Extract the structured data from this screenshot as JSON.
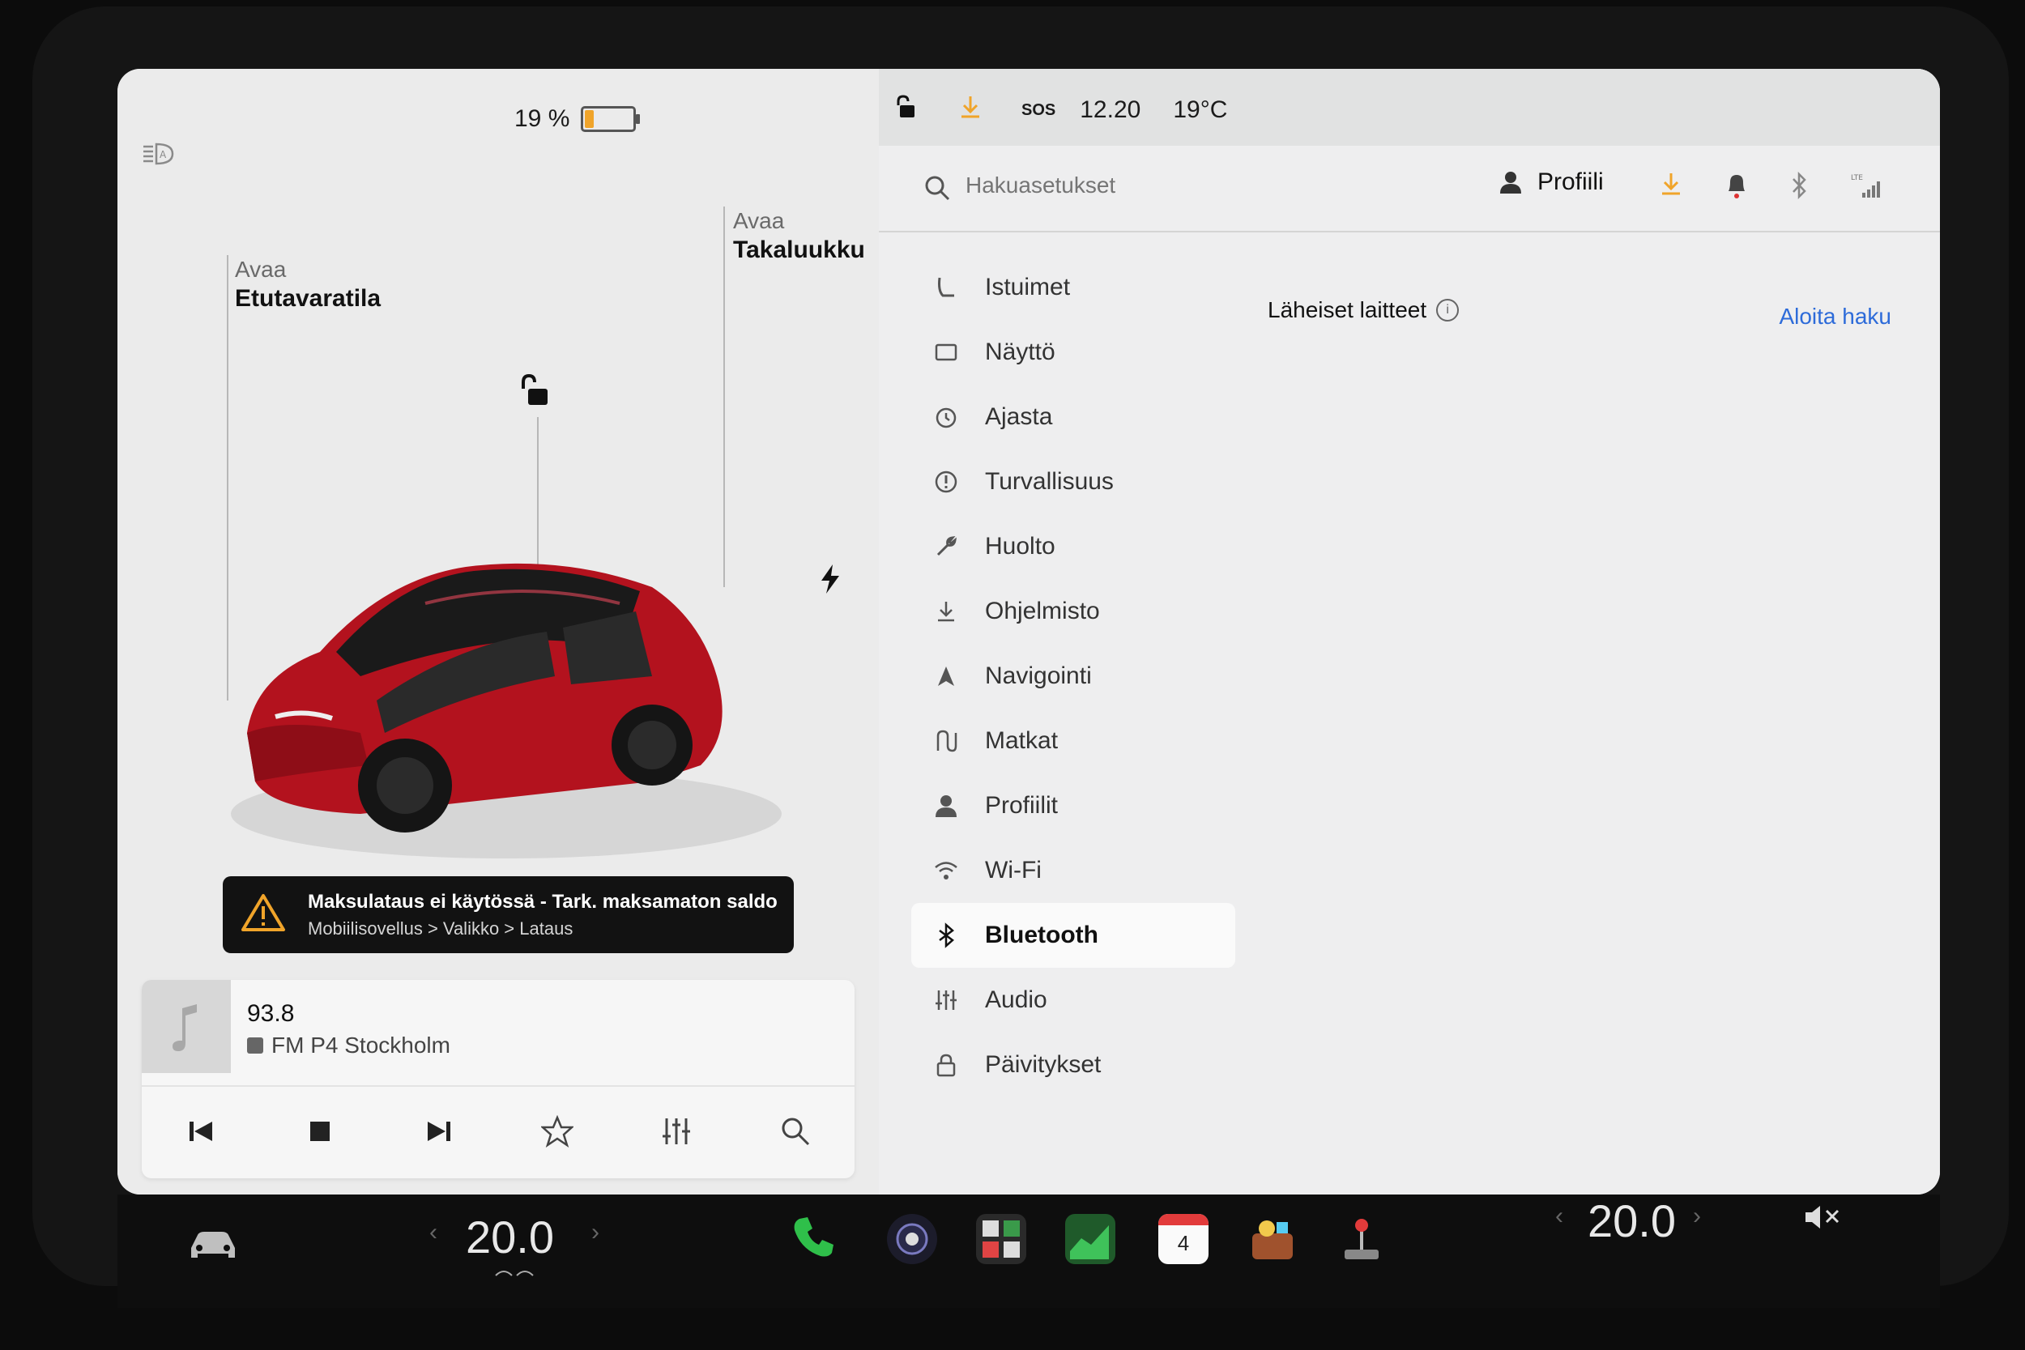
{
  "status": {
    "battery_percent": "19 %",
    "battery_level": 0.19,
    "time": "12.20",
    "temperature": "19°C",
    "sos": "SOS",
    "accent": "#f0a42a"
  },
  "car": {
    "frunk_label_top": "Avaa",
    "frunk_label_main": "Etutavaratila",
    "trunk_label_top": "Avaa",
    "trunk_label_main": "Takaluukku",
    "color": "#b3121e"
  },
  "alert": {
    "title": "Maksulataus ei käytössä - Tark. maksamaton saldo",
    "path": "Mobiilisovellus > Valikko > Lataus"
  },
  "media": {
    "frequency": "93.8",
    "station": "FM P4 Stockholm"
  },
  "settings": {
    "search_placeholder": "Hakuasetukset",
    "profile_label": "Profiili",
    "menu": [
      {
        "label": "Istuimet",
        "icon": "seat-icon"
      },
      {
        "label": "Näyttö",
        "icon": "display-icon"
      },
      {
        "label": "Ajasta",
        "icon": "alarm-icon"
      },
      {
        "label": "Turvallisuus",
        "icon": "safety-icon"
      },
      {
        "label": "Huolto",
        "icon": "wrench-icon"
      },
      {
        "label": "Ohjelmisto",
        "icon": "download-icon"
      },
      {
        "label": "Navigointi",
        "icon": "navigation-icon"
      },
      {
        "label": "Matkat",
        "icon": "trips-icon"
      },
      {
        "label": "Profiilit",
        "icon": "profile-icon"
      },
      {
        "label": "Wi-Fi",
        "icon": "wifi-icon"
      },
      {
        "label": "Bluetooth",
        "icon": "bluetooth-icon"
      },
      {
        "label": "Audio",
        "icon": "equalizer-icon"
      },
      {
        "label": "Päivitykset",
        "icon": "lock-icon"
      }
    ],
    "active_item": "Bluetooth",
    "nearby_devices": "Läheiset laitteet",
    "start_search": "Aloita haku",
    "link_color": "#2d6bd9"
  },
  "dock": {
    "driver_temp": "20.0",
    "passenger_temp": "20.0",
    "calendar_day": "4"
  }
}
